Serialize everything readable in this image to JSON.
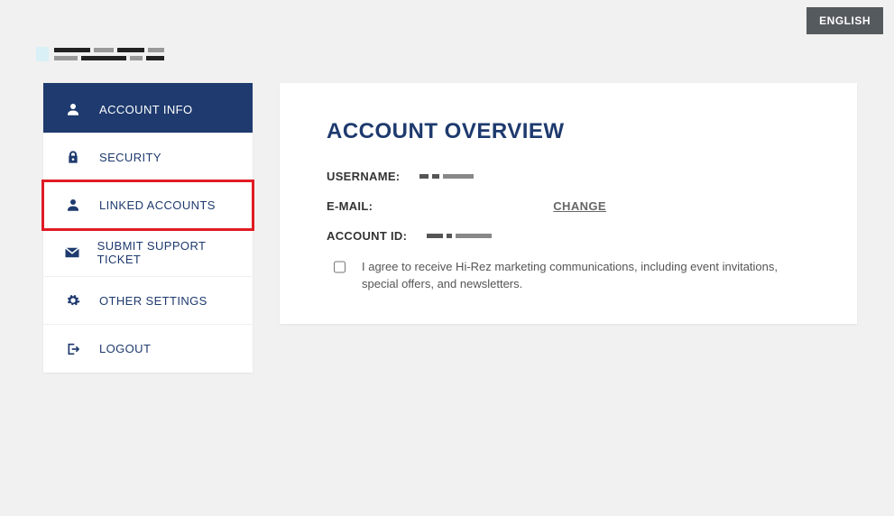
{
  "language_button": "ENGLISH",
  "sidebar": {
    "items": [
      {
        "label": "ACCOUNT INFO"
      },
      {
        "label": "SECURITY"
      },
      {
        "label": "LINKED ACCOUNTS"
      },
      {
        "label": "SUBMIT SUPPORT TICKET"
      },
      {
        "label": "OTHER SETTINGS"
      },
      {
        "label": "LOGOUT"
      }
    ]
  },
  "panel": {
    "title": "ACCOUNT OVERVIEW",
    "fields": {
      "username_label": "USERNAME:",
      "email_label": "E-MAIL:",
      "accountid_label": "ACCOUNT ID:",
      "change": "CHANGE"
    },
    "consent_text": "I agree to receive Hi-Rez marketing communications, including event invitations, special offers, and newsletters."
  }
}
